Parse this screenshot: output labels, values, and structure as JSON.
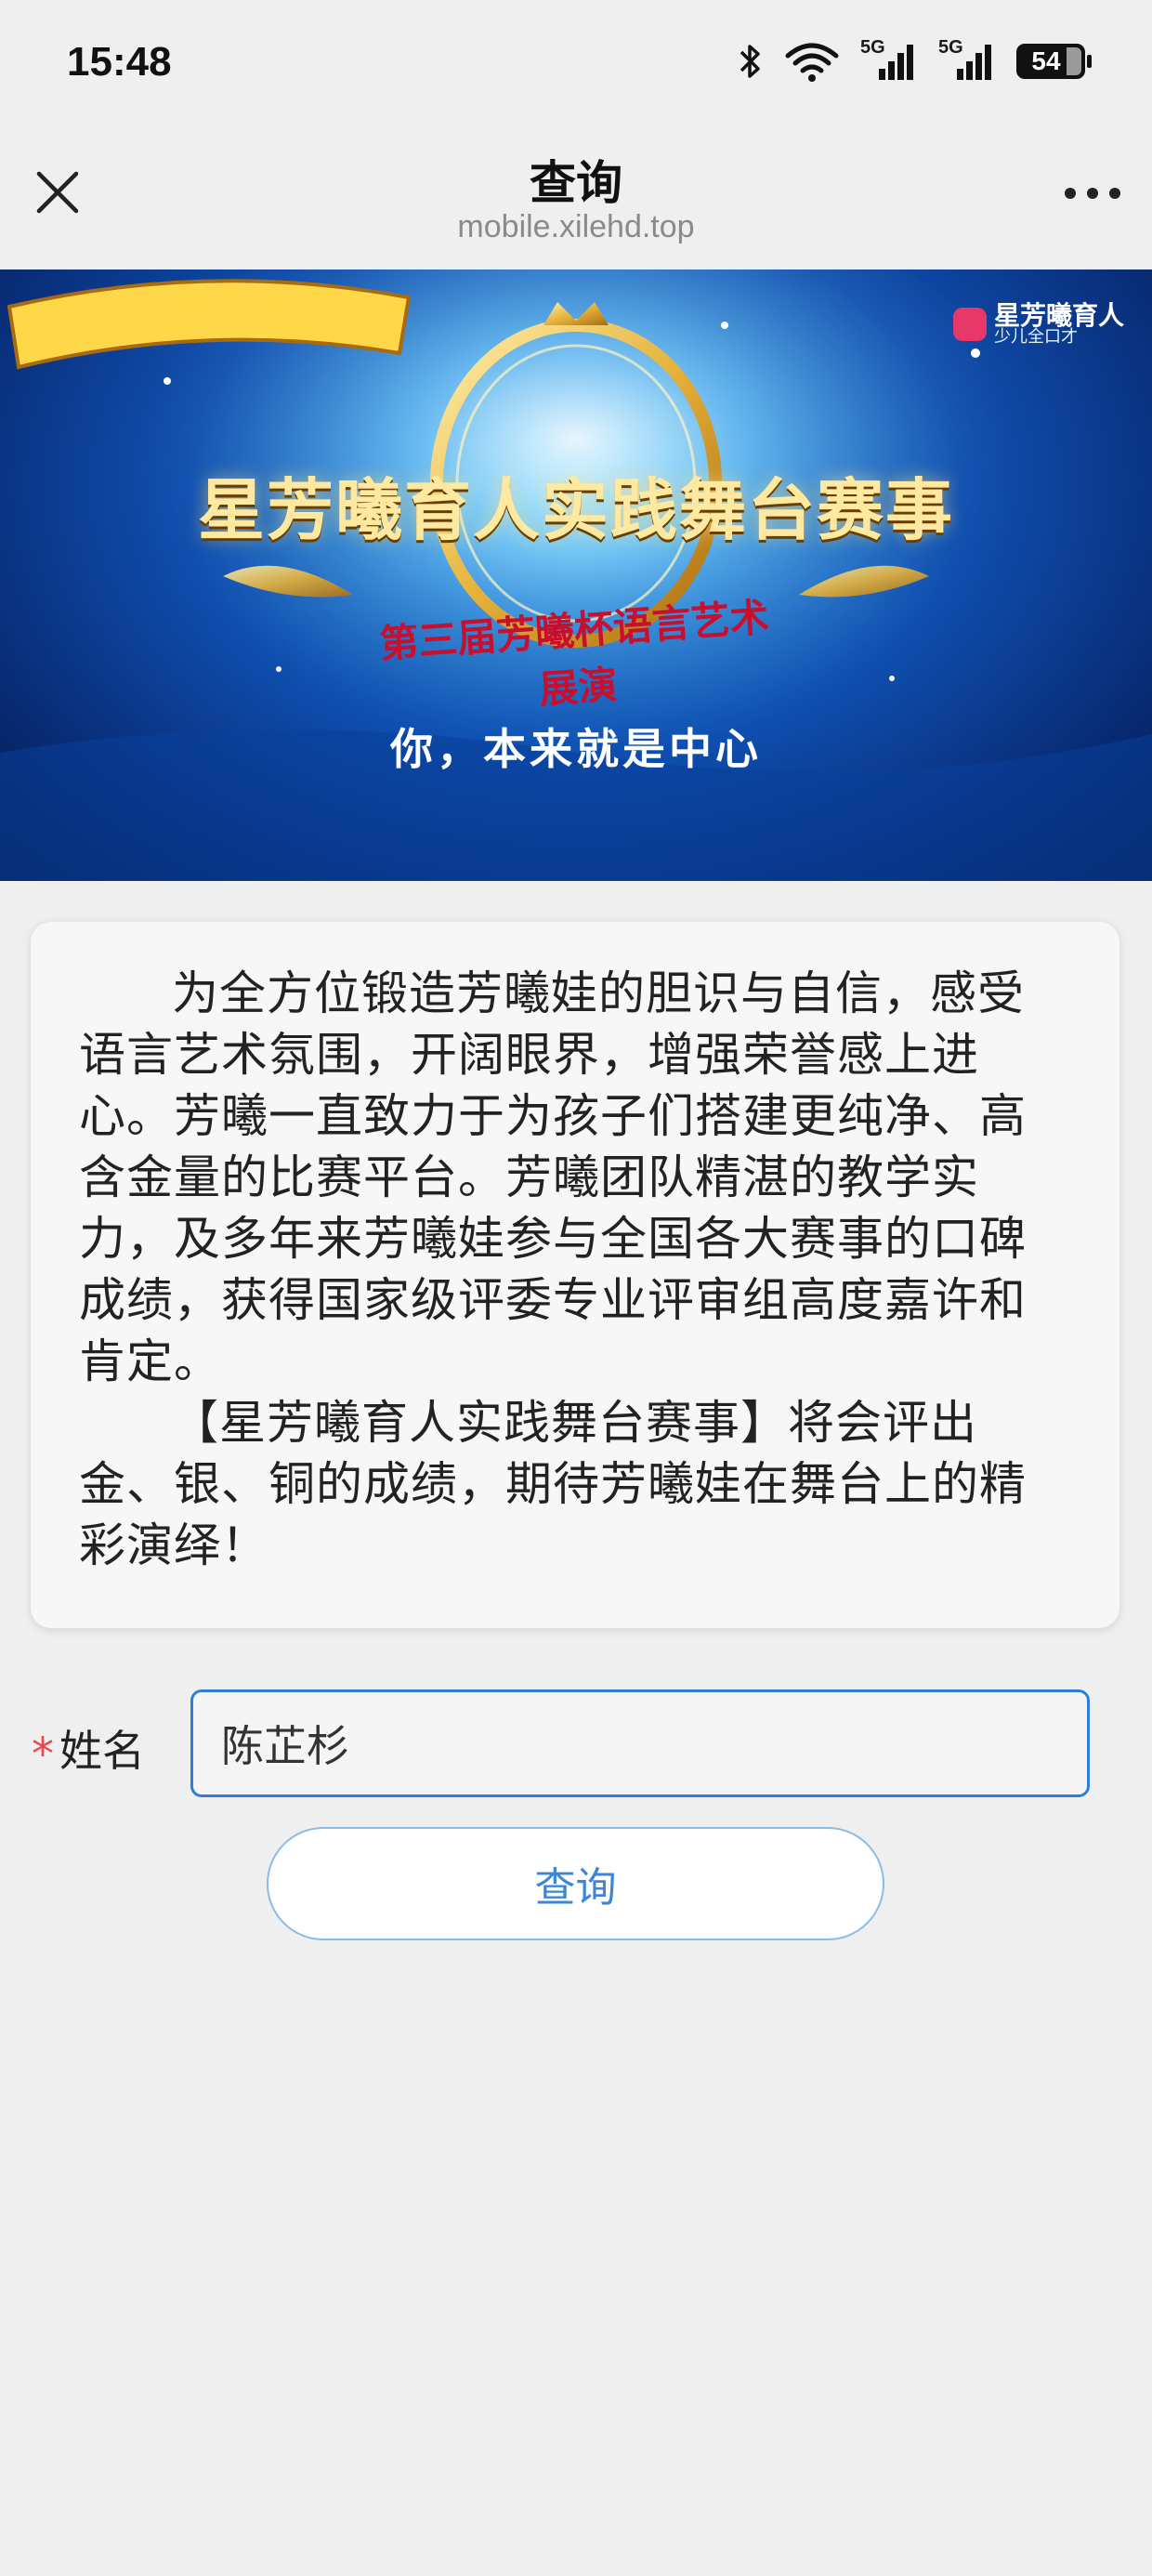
{
  "status_bar": {
    "time": "15:48",
    "network_labels": [
      "5G",
      "5G"
    ],
    "battery_level": "54",
    "icons": [
      "bluetooth-icon",
      "wifi-icon",
      "signal-5g-icon",
      "signal-5g-icon",
      "battery-icon"
    ]
  },
  "title_bar": {
    "title": "查询",
    "url": "mobile.xilehd.top",
    "close_icon": "close-icon",
    "more_icon": "more-icon"
  },
  "banner": {
    "logo_brand": "星芳曦育人",
    "logo_sub": "少儿全口才",
    "title": "星芳曦育人实践舞台赛事",
    "ribbon_text": "第三届芳曦杯语言艺术展演",
    "slogan": "你，本来就是中心"
  },
  "intro": {
    "paragraph1": "为全方位锻造芳曦娃的胆识与自信，感受语言艺术氛围，开阔眼界，增强荣誉感上进心。芳曦一直致力于为孩子们搭建更纯净、高含金量的比赛平台。芳曦团队精湛的教学实力，及多年来芳曦娃参与全国各大赛事的口碑成绩，获得国家级评委专业评审组高度嘉许和肯定。",
    "paragraph2": "【星芳曦育人实践舞台赛事】将会评出金、银、铜的成绩，期待芳曦娃在舞台上的精彩演绎！"
  },
  "form": {
    "required_mark": "*",
    "name_label": "姓名",
    "name_value": "陈芷杉",
    "submit_label": "查询"
  },
  "colors": {
    "accent": "#2f7fd8",
    "button_text": "#3d86d6",
    "required": "#e8494d",
    "page_bg": "#efeff0"
  }
}
